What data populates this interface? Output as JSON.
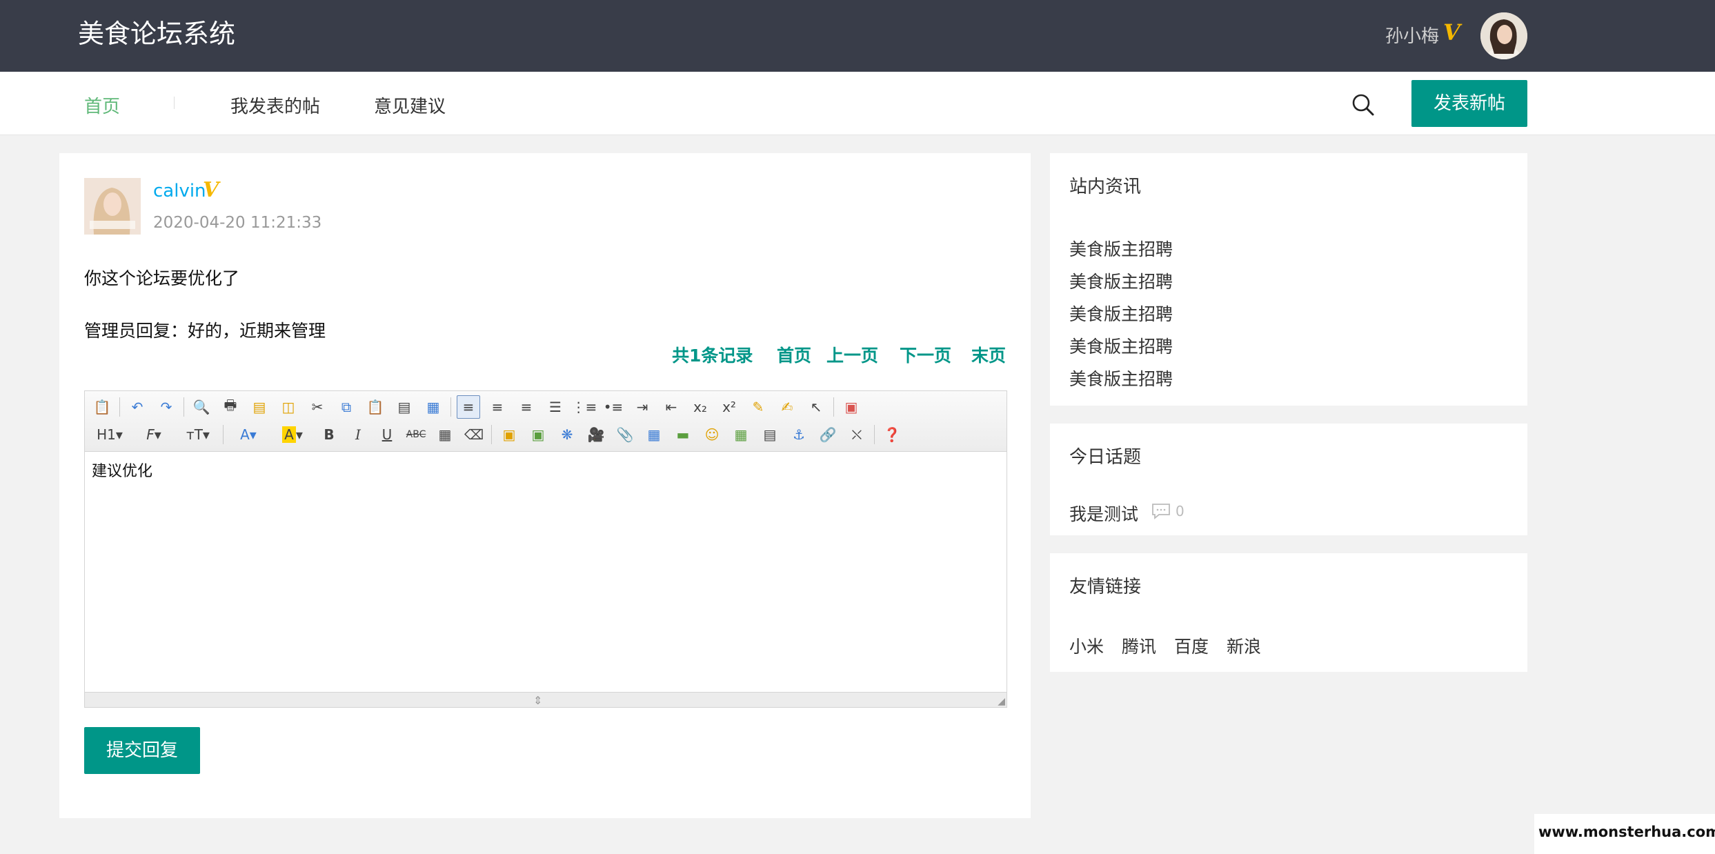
{
  "header": {
    "logo": "美食论坛系统",
    "user_name": "孙小梅",
    "user_badge": "V"
  },
  "nav": {
    "items": [
      "首页",
      "我发表的帖",
      "意见建议"
    ],
    "active_index": 0,
    "new_post_label": "发表新帖"
  },
  "post": {
    "author": "calvin",
    "author_badge": "V",
    "time": "2020-04-20 11:21:33",
    "content": "你这个论坛要优化了",
    "admin_reply": "管理员回复：好的，近期来管理"
  },
  "pager": {
    "total": "共1条记录",
    "first": "首页",
    "prev": "上一页",
    "next": "下一页",
    "last": "末页"
  },
  "editor": {
    "content": "建议优化",
    "toolbar_row1": [
      "source-icon",
      "undo-icon",
      "redo-icon",
      "preview-icon",
      "print-icon",
      "template-icon",
      "code-icon",
      "cut-icon",
      "copy-icon",
      "paste-icon",
      "paste-plain-icon",
      "paste-word-icon",
      "align-left-icon",
      "align-center-icon",
      "align-right-icon",
      "align-justify-icon",
      "ordered-list-icon",
      "unordered-list-icon",
      "indent-icon",
      "outdent-icon",
      "subscript-icon",
      "superscript-icon",
      "clear-format-icon",
      "quick-format-icon",
      "select-all-icon",
      "fullscreen-icon"
    ],
    "toolbar_row2": [
      "heading-icon",
      "font-family-icon",
      "font-size-icon",
      "font-color-icon",
      "highlight-icon",
      "bold-icon",
      "italic-icon",
      "underline-icon",
      "strikethrough-icon",
      "line-height-icon",
      "remove-format-icon",
      "image-icon",
      "multi-image-icon",
      "flash-icon",
      "media-icon",
      "attachment-icon",
      "table-icon",
      "horizontal-rule-icon",
      "emoticon-icon",
      "map-icon",
      "page-break-icon",
      "anchor-icon",
      "link-icon",
      "unlink-icon",
      "help-icon"
    ]
  },
  "submit_label": "提交回复",
  "sidebar": {
    "news": {
      "title": "站内资讯",
      "items": [
        "美食版主招聘",
        "美食版主招聘",
        "美食版主招聘",
        "美食版主招聘",
        "美食版主招聘"
      ]
    },
    "topics": {
      "title": "今日话题",
      "items": [
        {
          "title": "我是测试",
          "comments": "0"
        }
      ]
    },
    "links": {
      "title": "友情链接",
      "items": [
        "小米",
        "腾讯",
        "百度",
        "新浪"
      ]
    }
  },
  "watermark": "www.monsterhua.com",
  "colors": {
    "topbar": "#393d49",
    "accent_green": "#009688",
    "nav_active": "#5fb878",
    "author_blue": "#01aaed",
    "badge_gold": "#f5b800"
  }
}
